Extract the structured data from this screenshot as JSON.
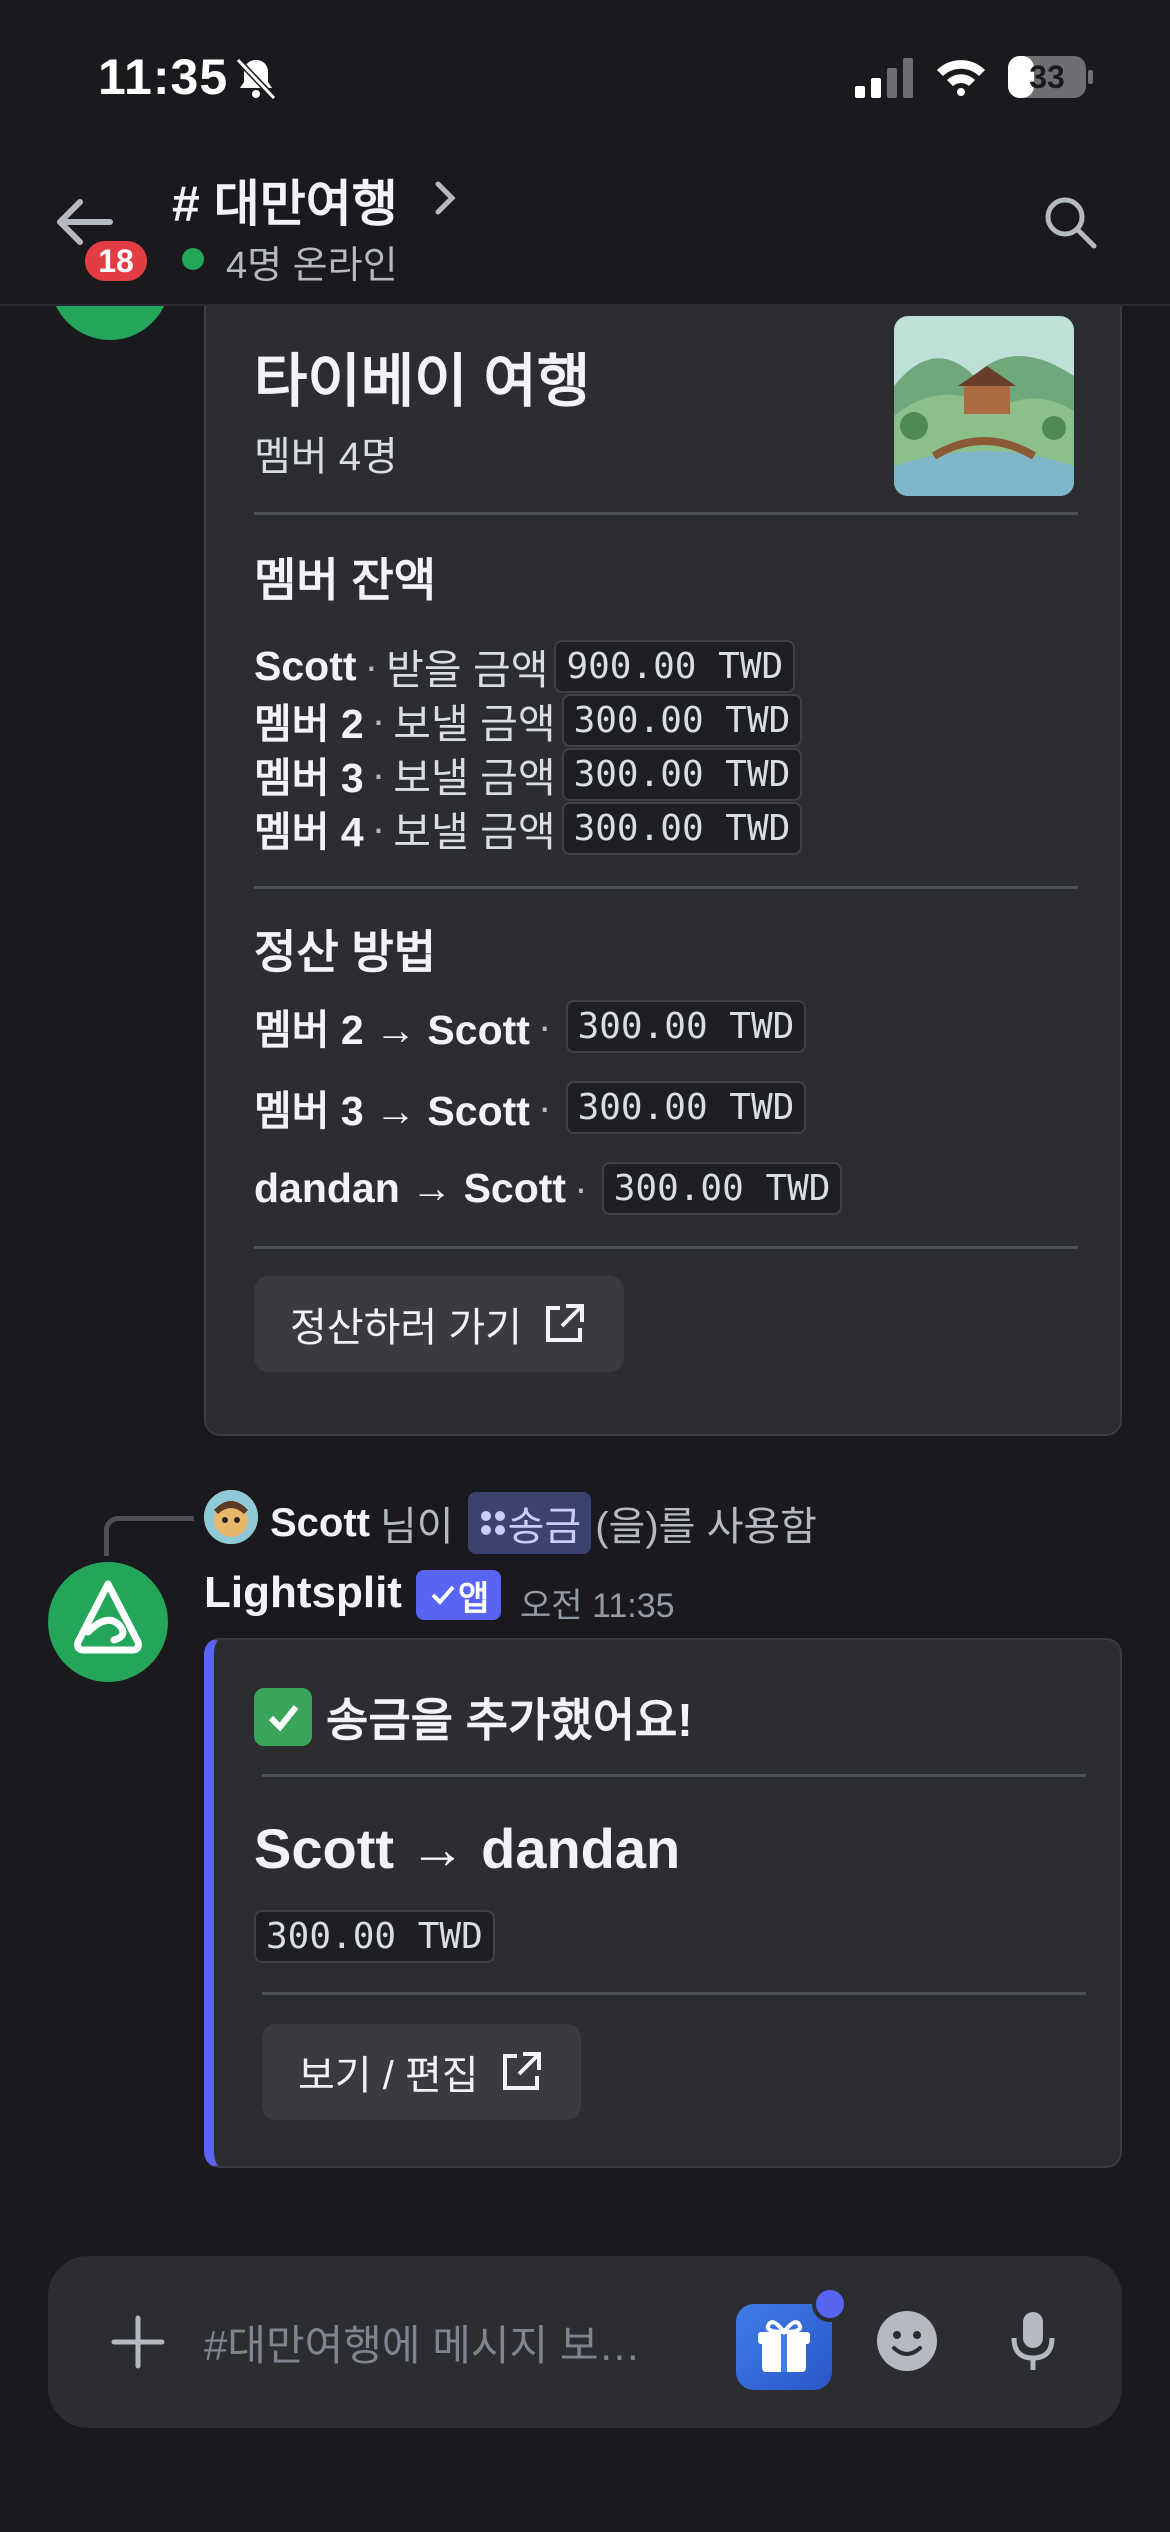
{
  "status_bar": {
    "time": "11:35",
    "battery": "33"
  },
  "header": {
    "channel": "# 대만여행",
    "unread_count": "18",
    "online": "4명 온라인"
  },
  "group_embed": {
    "title": "타이베이 여행",
    "members_count": "멤버 4명",
    "balances_heading": "멤버 잔액",
    "balances": [
      {
        "name": "Scott",
        "action": "받을 금액",
        "amount": "900.00 TWD"
      },
      {
        "name": "멤버 2",
        "action": "보낼 금액",
        "amount": "300.00 TWD"
      },
      {
        "name": "멤버 3",
        "action": "보낼 금액",
        "amount": "300.00 TWD"
      },
      {
        "name": "멤버 4",
        "action": "보낼 금액",
        "amount": "300.00 TWD"
      }
    ],
    "settle_heading": "정산 방법",
    "settlements": [
      {
        "text": "멤버 2 → Scott",
        "amount": "300.00 TWD"
      },
      {
        "text": "멤버 3 → Scott",
        "amount": "300.00 TWD"
      },
      {
        "text": "dandan → Scott",
        "amount": "300.00 TWD"
      }
    ],
    "button": "정산하러 가기"
  },
  "reply": {
    "user": "Scott",
    "suffix_1": "님이",
    "command": "송금",
    "suffix_2": "(을)를 사용함"
  },
  "bot_message": {
    "name": "Lightsplit",
    "badge": "앱",
    "time": "오전 11:35",
    "embed_title": "송금을 추가했어요!",
    "transfer": "Scott → dandan",
    "amount": "300.00 TWD",
    "button": "보기 / 편집"
  },
  "composer": {
    "placeholder": "#대만여행에 메시지 보…"
  }
}
